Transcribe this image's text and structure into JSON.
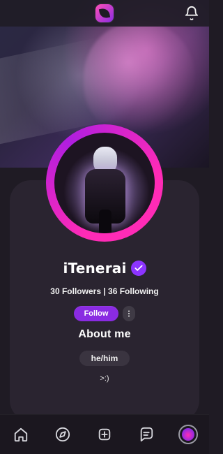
{
  "header": {
    "logo_icon": "app-logo",
    "notifications_icon": "bell-icon"
  },
  "profile": {
    "username": "iTenerai",
    "verified_icon": "verified-check-icon",
    "followers_following": "30 Followers | 36 Following",
    "follow_label": "Follow",
    "more_icon": "more-vertical-icon",
    "about_title": "About me",
    "pronouns": "he/him",
    "bio": ">:)"
  },
  "bottom_nav": {
    "items": [
      {
        "name": "home",
        "icon": "home-icon"
      },
      {
        "name": "explore",
        "icon": "compass-icon"
      },
      {
        "name": "create",
        "icon": "plus-square-icon"
      },
      {
        "name": "messages",
        "icon": "chat-icon"
      },
      {
        "name": "profile",
        "icon": "profile-avatar-icon"
      }
    ]
  },
  "colors": {
    "background": "#1f1b24",
    "card": "#2a2430",
    "accent": "#8a2be2",
    "accent_pink": "#ff2bb6"
  }
}
